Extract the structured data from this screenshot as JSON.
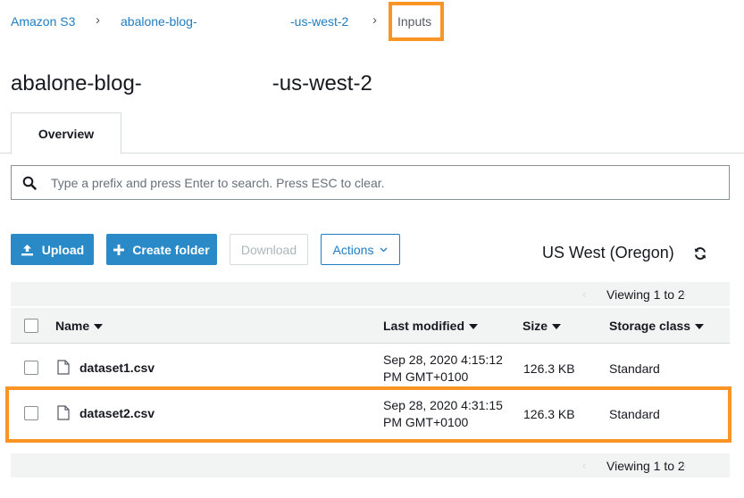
{
  "breadcrumb": {
    "root": "Amazon S3",
    "bucket_prefix": "abalone-blog-",
    "bucket_suffix": "-us-west-2",
    "current": "Inputs",
    "separator": "›"
  },
  "page": {
    "title_prefix": "abalone-blog-",
    "title_suffix": "-us-west-2"
  },
  "tabs": [
    {
      "label": "Overview"
    }
  ],
  "search": {
    "placeholder": "Type a prefix and press Enter to search. Press ESC to clear.",
    "value": ""
  },
  "toolbar": {
    "upload_label": "Upload",
    "create_folder_label": "Create folder",
    "download_label": "Download",
    "actions_label": "Actions",
    "region": "US West (Oregon)"
  },
  "pager": {
    "top_text": "Viewing 1 to 2",
    "bottom_text": "Viewing 1 to 2"
  },
  "table": {
    "columns": {
      "name": "Name",
      "last_modified": "Last modified",
      "size": "Size",
      "storage_class": "Storage class"
    },
    "rows": [
      {
        "name": "dataset1.csv",
        "modified_line1": "Sep 28, 2020 4:15:12",
        "modified_line2": "PM GMT+0100",
        "size": "126.3 KB",
        "storage_class": "Standard"
      },
      {
        "name": "dataset2.csv",
        "modified_line1": "Sep 28, 2020 4:31:15",
        "modified_line2": "PM GMT+0100",
        "size": "126.3 KB",
        "storage_class": "Standard"
      }
    ]
  },
  "colors": {
    "link": "#1f7dc1",
    "primary_button": "#2a8ac8",
    "highlight": "#f89524"
  }
}
